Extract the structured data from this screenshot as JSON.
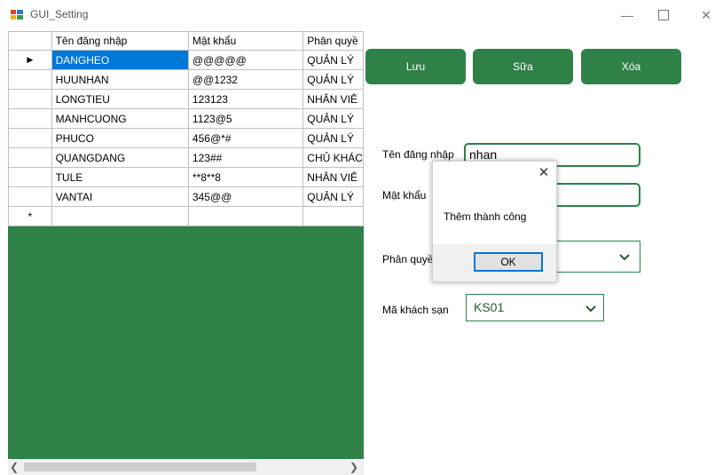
{
  "window": {
    "title": "GUI_Setting"
  },
  "grid": {
    "headers": [
      "Tên đăng nhập",
      "Mật khẩu",
      "Phân quyề"
    ],
    "rows": [
      [
        "DANGHEO",
        "@@@@@",
        "QUẢN LÝ"
      ],
      [
        "HUUNHAN",
        "@@1232",
        "QUẢN LÝ"
      ],
      [
        "LONGTIEU",
        "123123",
        "NHÂN VIÊ"
      ],
      [
        "MANHCUONG",
        "1123@5",
        "QUẢN LÝ"
      ],
      [
        "PHUCO",
        "456@*#",
        "QUẢN LÝ"
      ],
      [
        "QUANGDANG",
        "123##",
        "CHỦ KHÁC"
      ],
      [
        "TULE",
        "**8**8",
        "NHÂN VIÊ"
      ],
      [
        "VANTAI",
        "345@@",
        "QUẢN LÝ"
      ]
    ],
    "current_row_marker": "▶",
    "new_row_marker": "*"
  },
  "buttons": {
    "save": "Lưu",
    "edit": "Sữa",
    "delete": "Xóa"
  },
  "form": {
    "username_label": "Tên đăng nhập",
    "username_value": "nhan",
    "password_label": "Mật khẩu",
    "role_label": "Phân quyền",
    "hotel_label": "Mã khách sạn",
    "hotel_value": "KS01"
  },
  "dialog": {
    "message": "Thêm thành công",
    "ok_label": "OK",
    "close_glyph": "✕"
  },
  "colors": {
    "accent": "#2f8148",
    "selection": "#0078d7"
  }
}
